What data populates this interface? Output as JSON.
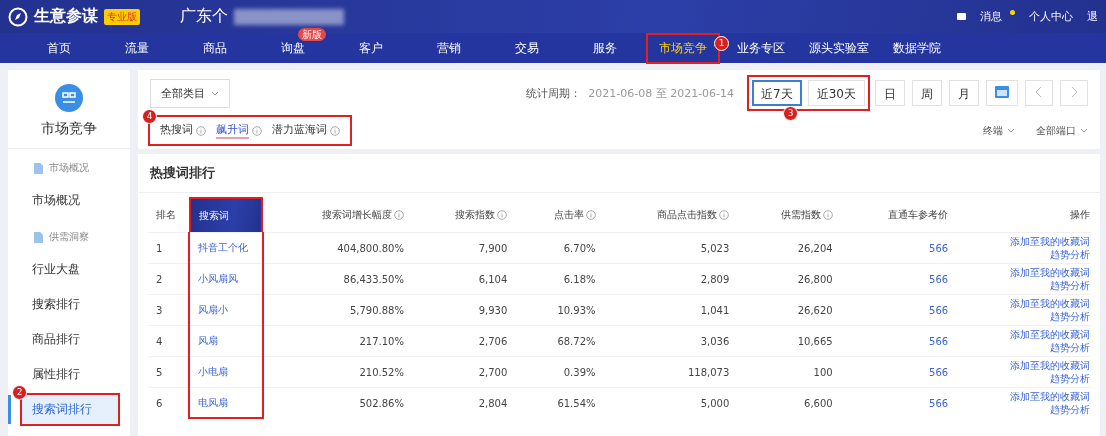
{
  "header": {
    "brand": "生意参谋",
    "edition": "专业版",
    "shop": "广东个",
    "links": [
      "消息",
      "个人中心",
      "退"
    ]
  },
  "nav": [
    {
      "label": "首页",
      "selected": false,
      "highlighted": false
    },
    {
      "label": "流量",
      "selected": false,
      "highlighted": false
    },
    {
      "label": "商品",
      "selected": false,
      "highlighted": false
    },
    {
      "label": "询盘",
      "selected": false,
      "highlighted": false,
      "badge": "新版"
    },
    {
      "label": "客户",
      "selected": false,
      "highlighted": false
    },
    {
      "label": "营销",
      "selected": false,
      "highlighted": false
    },
    {
      "label": "交易",
      "selected": false,
      "highlighted": false
    },
    {
      "label": "服务",
      "selected": false,
      "highlighted": false
    },
    {
      "label": "市场竞争",
      "selected": true,
      "highlighted": true,
      "marker": "1"
    },
    {
      "label": "业务专区",
      "selected": false,
      "highlighted": false
    },
    {
      "label": "源头实验室",
      "selected": false,
      "highlighted": false
    },
    {
      "label": "数据学院",
      "selected": false,
      "highlighted": false
    }
  ],
  "sidebar": {
    "title": "市场竞争",
    "sections": [
      {
        "label": "市场概况",
        "items": [
          {
            "label": "市场概况",
            "selected": false,
            "highlighted": false
          }
        ]
      },
      {
        "label": "供需洞察",
        "items": [
          {
            "label": "行业大盘",
            "selected": false,
            "highlighted": false
          },
          {
            "label": "搜索排行",
            "selected": false,
            "highlighted": false
          },
          {
            "label": "商品排行",
            "selected": false,
            "highlighted": false
          },
          {
            "label": "属性排行",
            "selected": false,
            "highlighted": false
          },
          {
            "label": "搜索词排行",
            "selected": true,
            "highlighted": true,
            "marker": "2"
          }
        ]
      }
    ]
  },
  "toolbar": {
    "category": "全部类目",
    "period_label": "统计周期：",
    "period": "2021-06-08 至 2021-06-14",
    "ranges": [
      {
        "label": "近7天",
        "selected": true
      },
      {
        "label": "近30天",
        "selected": false
      }
    ],
    "ranges_highlighted": true,
    "ranges_marker": "3",
    "units": [
      "日",
      "周",
      "月"
    ]
  },
  "tabs": [
    {
      "label": "热搜词",
      "selected": false
    },
    {
      "label": "飙升词",
      "selected": true
    },
    {
      "label": "潜力蓝海词",
      "selected": false
    }
  ],
  "tabs_highlighted": true,
  "tabs_marker": "4",
  "filters": [
    "终端",
    "全部端口"
  ],
  "table": {
    "title": "热搜词排行",
    "word_column_highlighted": true,
    "columns": [
      "排名",
      "搜索词",
      "搜索词增长幅度",
      "搜索指数",
      "点击率",
      "商品点击指数",
      "供需指数",
      "直通车参考价",
      "操作"
    ],
    "rows": [
      {
        "cells": [
          "1",
          "抖音工个化",
          "404,800.80%",
          "7,900",
          "6.70%",
          "5,023",
          "26,204",
          "566"
        ],
        "actions": [
          "添加至我的收藏词",
          "趋势分析"
        ]
      },
      {
        "cells": [
          "2",
          "小风扇风",
          "86,433.50%",
          "6,104",
          "6.18%",
          "2,809",
          "26,800",
          "566"
        ],
        "actions": [
          "添加至我的收藏词",
          "趋势分析"
        ]
      },
      {
        "cells": [
          "3",
          "风扇小",
          "5,790.88%",
          "9,930",
          "10.93%",
          "1,041",
          "26,620",
          "566"
        ],
        "actions": [
          "添加至我的收藏词",
          "趋势分析"
        ]
      },
      {
        "cells": [
          "4",
          "风扇",
          "217.10%",
          "2,706",
          "68.72%",
          "3,036",
          "10,665",
          "566"
        ],
        "actions": [
          "添加至我的收藏词",
          "趋势分析"
        ]
      },
      {
        "cells": [
          "5",
          "小电扇",
          "210.52%",
          "2,700",
          "0.39%",
          "118,073",
          "100",
          "566"
        ],
        "actions": [
          "添加至我的收藏词",
          "趋势分析"
        ]
      },
      {
        "cells": [
          "6",
          "电风扇",
          "502.86%",
          "2,804",
          "61.54%",
          "5,000",
          "6,600",
          "566"
        ],
        "actions": [
          "添加至我的收藏词",
          "趋势分析"
        ]
      }
    ]
  }
}
